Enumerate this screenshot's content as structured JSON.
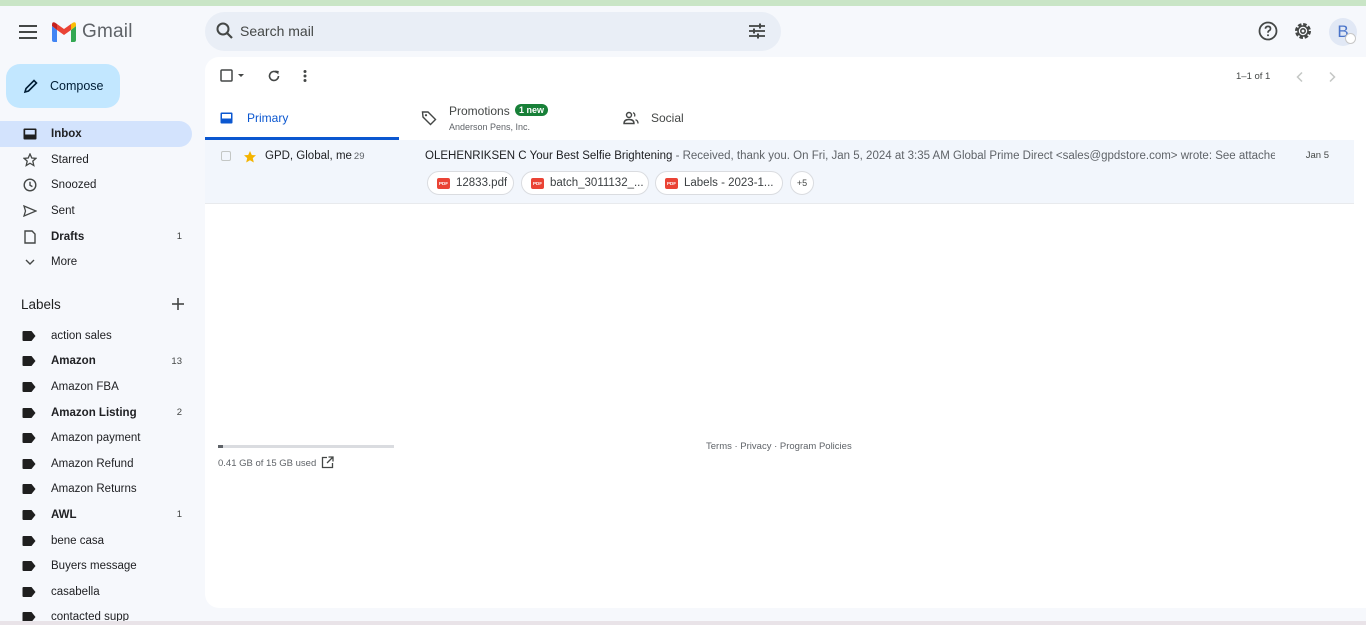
{
  "app": {
    "name": "Gmail"
  },
  "search": {
    "placeholder": "Search mail"
  },
  "header": {
    "avatar_letter": "B"
  },
  "compose_label": "Compose",
  "nav": [
    {
      "label": "Inbox",
      "icon": "inbox-icon",
      "count": "",
      "active": true,
      "bold": true
    },
    {
      "label": "Starred",
      "icon": "star-icon",
      "count": ""
    },
    {
      "label": "Snoozed",
      "icon": "clock-icon",
      "count": ""
    },
    {
      "label": "Sent",
      "icon": "send-icon",
      "count": ""
    },
    {
      "label": "Drafts",
      "icon": "draft-icon",
      "count": "1",
      "bold": true
    },
    {
      "label": "More",
      "icon": "chevron-down-icon",
      "count": ""
    }
  ],
  "labels_title": "Labels",
  "labels": [
    {
      "label": "action sales",
      "count": ""
    },
    {
      "label": "Amazon",
      "count": "13",
      "bold": true
    },
    {
      "label": "Amazon FBA",
      "count": ""
    },
    {
      "label": "Amazon Listing",
      "count": "2",
      "bold": true
    },
    {
      "label": "Amazon payment",
      "count": ""
    },
    {
      "label": "Amazon Refund",
      "count": ""
    },
    {
      "label": "Amazon Returns",
      "count": ""
    },
    {
      "label": "AWL",
      "count": "1",
      "bold": true
    },
    {
      "label": "bene casa",
      "count": ""
    },
    {
      "label": "Buyers message",
      "count": ""
    },
    {
      "label": "casabella",
      "count": ""
    },
    {
      "label": "contacted supp",
      "count": ""
    }
  ],
  "pager": "1–1 of 1",
  "tabs": {
    "primary": "Primary",
    "promotions": "Promotions",
    "promotions_badge": "1 new",
    "promotions_sub": "Anderson Pens, Inc.",
    "social": "Social"
  },
  "email": {
    "sender": "GPD, Global, me",
    "thread_count": "29",
    "subject": "OLEHENRIKSEN C Your Best Selfie Brightening",
    "snippet": " - Received, thank you. On Fri, Jan 5, 2024 at 3:35 AM Global Prime Direct <sales@gpdstore.com> wrote: See attached...",
    "date": "Jan 5",
    "starred": true,
    "attachments": [
      "12833.pdf",
      "batch_3011132_...",
      "Labels - 2023-1..."
    ],
    "more_attachments": "+5"
  },
  "storage": {
    "text": "0.41 GB of 15 GB used",
    "used_fraction": 0.027
  },
  "footer": "Terms · Privacy · Program Policies",
  "colors": {
    "accent": "#0b57d0",
    "compose_bg": "#c2e7ff",
    "active_nav": "#d3e3fd",
    "badge_green": "#188038"
  }
}
